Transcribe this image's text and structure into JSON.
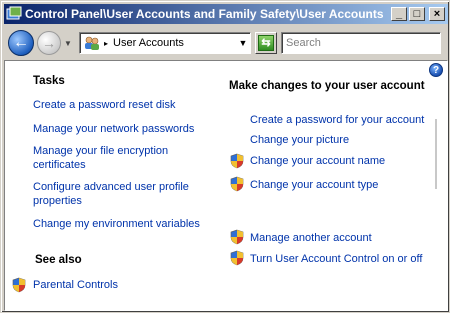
{
  "window": {
    "title": "Control Panel\\User Accounts and Family Safety\\User Accounts",
    "minimize_label": "_",
    "maximize_label": "□",
    "close_label": "×"
  },
  "navbar": {
    "back_glyph": "←",
    "forward_glyph": "→",
    "address_text": "User Accounts",
    "search_placeholder": "Search"
  },
  "tasks": {
    "heading": "Tasks",
    "items": [
      "Create a password reset disk",
      "Manage your network passwords",
      "Manage your file encryption certificates",
      "Configure advanced user profile properties",
      "Change my environment variables"
    ]
  },
  "see_also": {
    "heading": "See also",
    "items": [
      "Parental Controls"
    ]
  },
  "main": {
    "heading": "Make changes to your user account",
    "items": [
      "Create a password for your account",
      "Change your picture",
      "Change your account name",
      "Change your account type",
      "Manage another account",
      "Turn User Account Control on or off"
    ]
  },
  "help_label": "?",
  "colors": {
    "link": "#0033aa",
    "titlebar_start": "#0a246a",
    "titlebar_end": "#a6caf0"
  }
}
